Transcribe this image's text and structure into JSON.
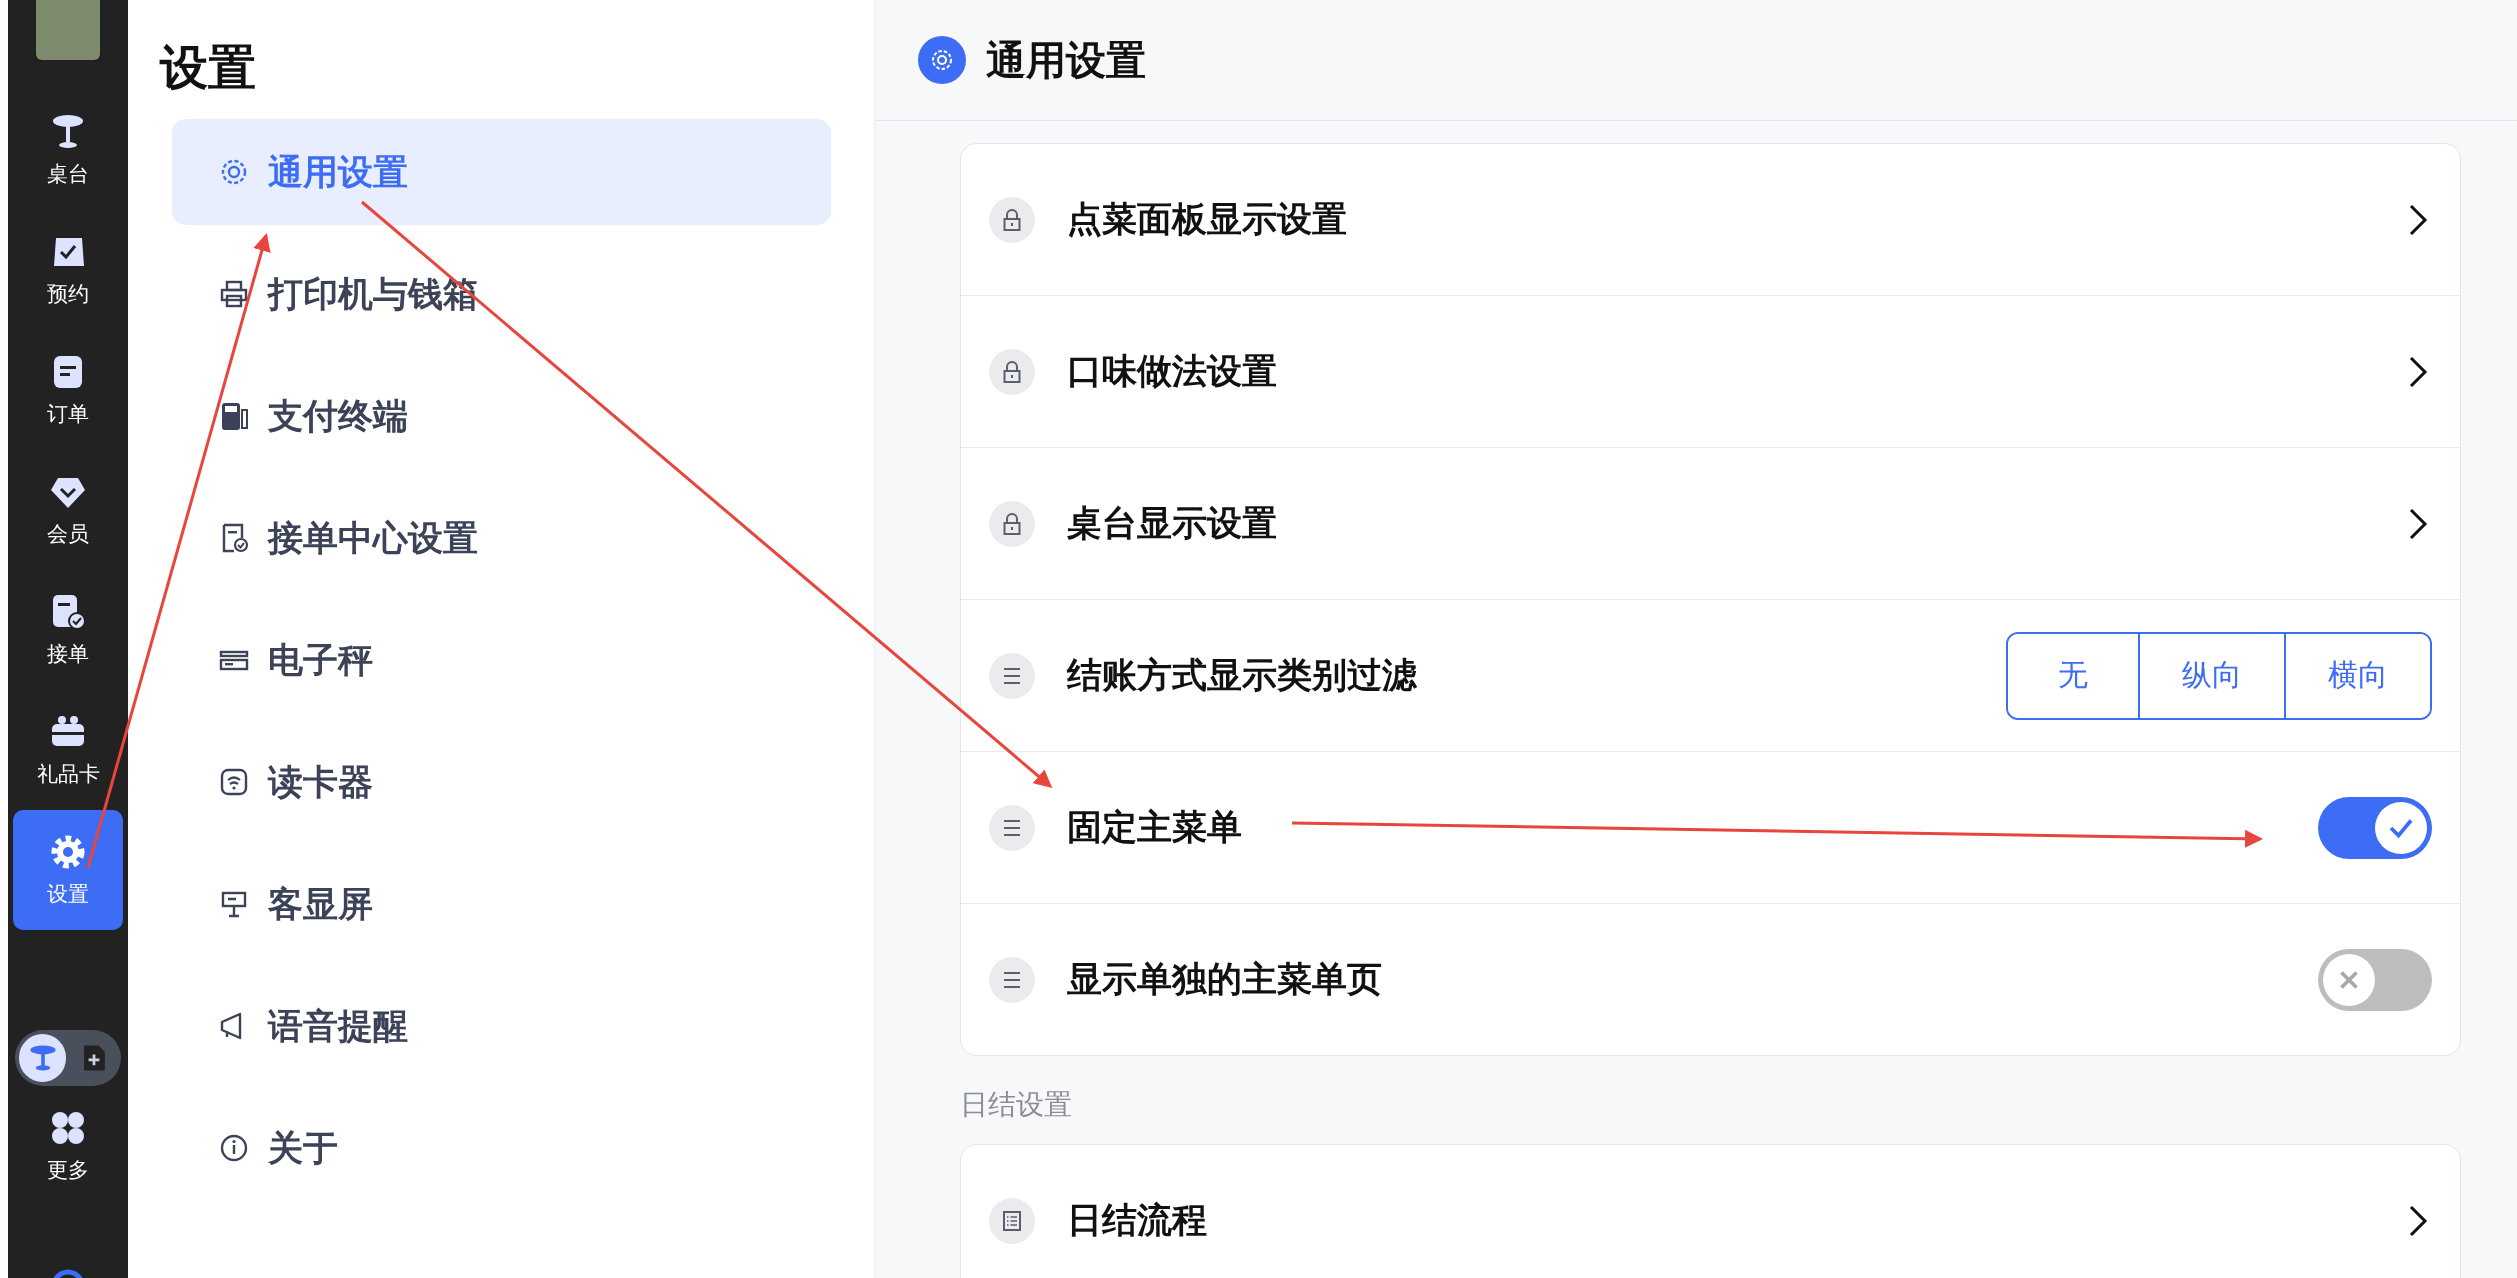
{
  "nav": {
    "items": [
      {
        "label": "桌台",
        "selected": false
      },
      {
        "label": "预约",
        "selected": false
      },
      {
        "label": "订单",
        "selected": false
      },
      {
        "label": "会员",
        "selected": false
      },
      {
        "label": "接单",
        "selected": false
      },
      {
        "label": "礼品卡",
        "selected": false
      },
      {
        "label": "设置",
        "selected": true
      }
    ],
    "mode_switch": [
      {
        "selected": true
      },
      {
        "selected": false
      }
    ],
    "more": {
      "label": "更多"
    }
  },
  "sidebar": {
    "title": "设置",
    "items": [
      {
        "label": "通用设置",
        "selected": true
      },
      {
        "label": "打印机与钱箱",
        "selected": false
      },
      {
        "label": "支付终端",
        "selected": false
      },
      {
        "label": "接单中心设置",
        "selected": false
      },
      {
        "label": "电子秤",
        "selected": false
      },
      {
        "label": "读卡器",
        "selected": false
      },
      {
        "label": "客显屏",
        "selected": false
      },
      {
        "label": "语音提醒",
        "selected": false
      },
      {
        "label": "关于",
        "selected": false
      }
    ]
  },
  "page": {
    "title": "通用设置",
    "sections": [
      {
        "rows": [
          {
            "kind": "link",
            "label": "点菜面板显示设置"
          },
          {
            "kind": "link",
            "label": "口味做法设置"
          },
          {
            "kind": "link",
            "label": "桌台显示设置"
          },
          {
            "kind": "segmented",
            "label": "结账方式显示类别过滤",
            "options": [
              {
                "label": "无",
                "selected": false
              },
              {
                "label": "纵向",
                "selected": false
              },
              {
                "label": "横向",
                "selected": false
              }
            ]
          },
          {
            "kind": "toggle",
            "label": "固定主菜单",
            "on": true
          },
          {
            "kind": "toggle",
            "label": "显示单独的主菜单页",
            "on": false
          }
        ]
      },
      {
        "title": "日结设置",
        "rows": [
          {
            "kind": "link",
            "label": "日结流程"
          }
        ]
      }
    ]
  }
}
